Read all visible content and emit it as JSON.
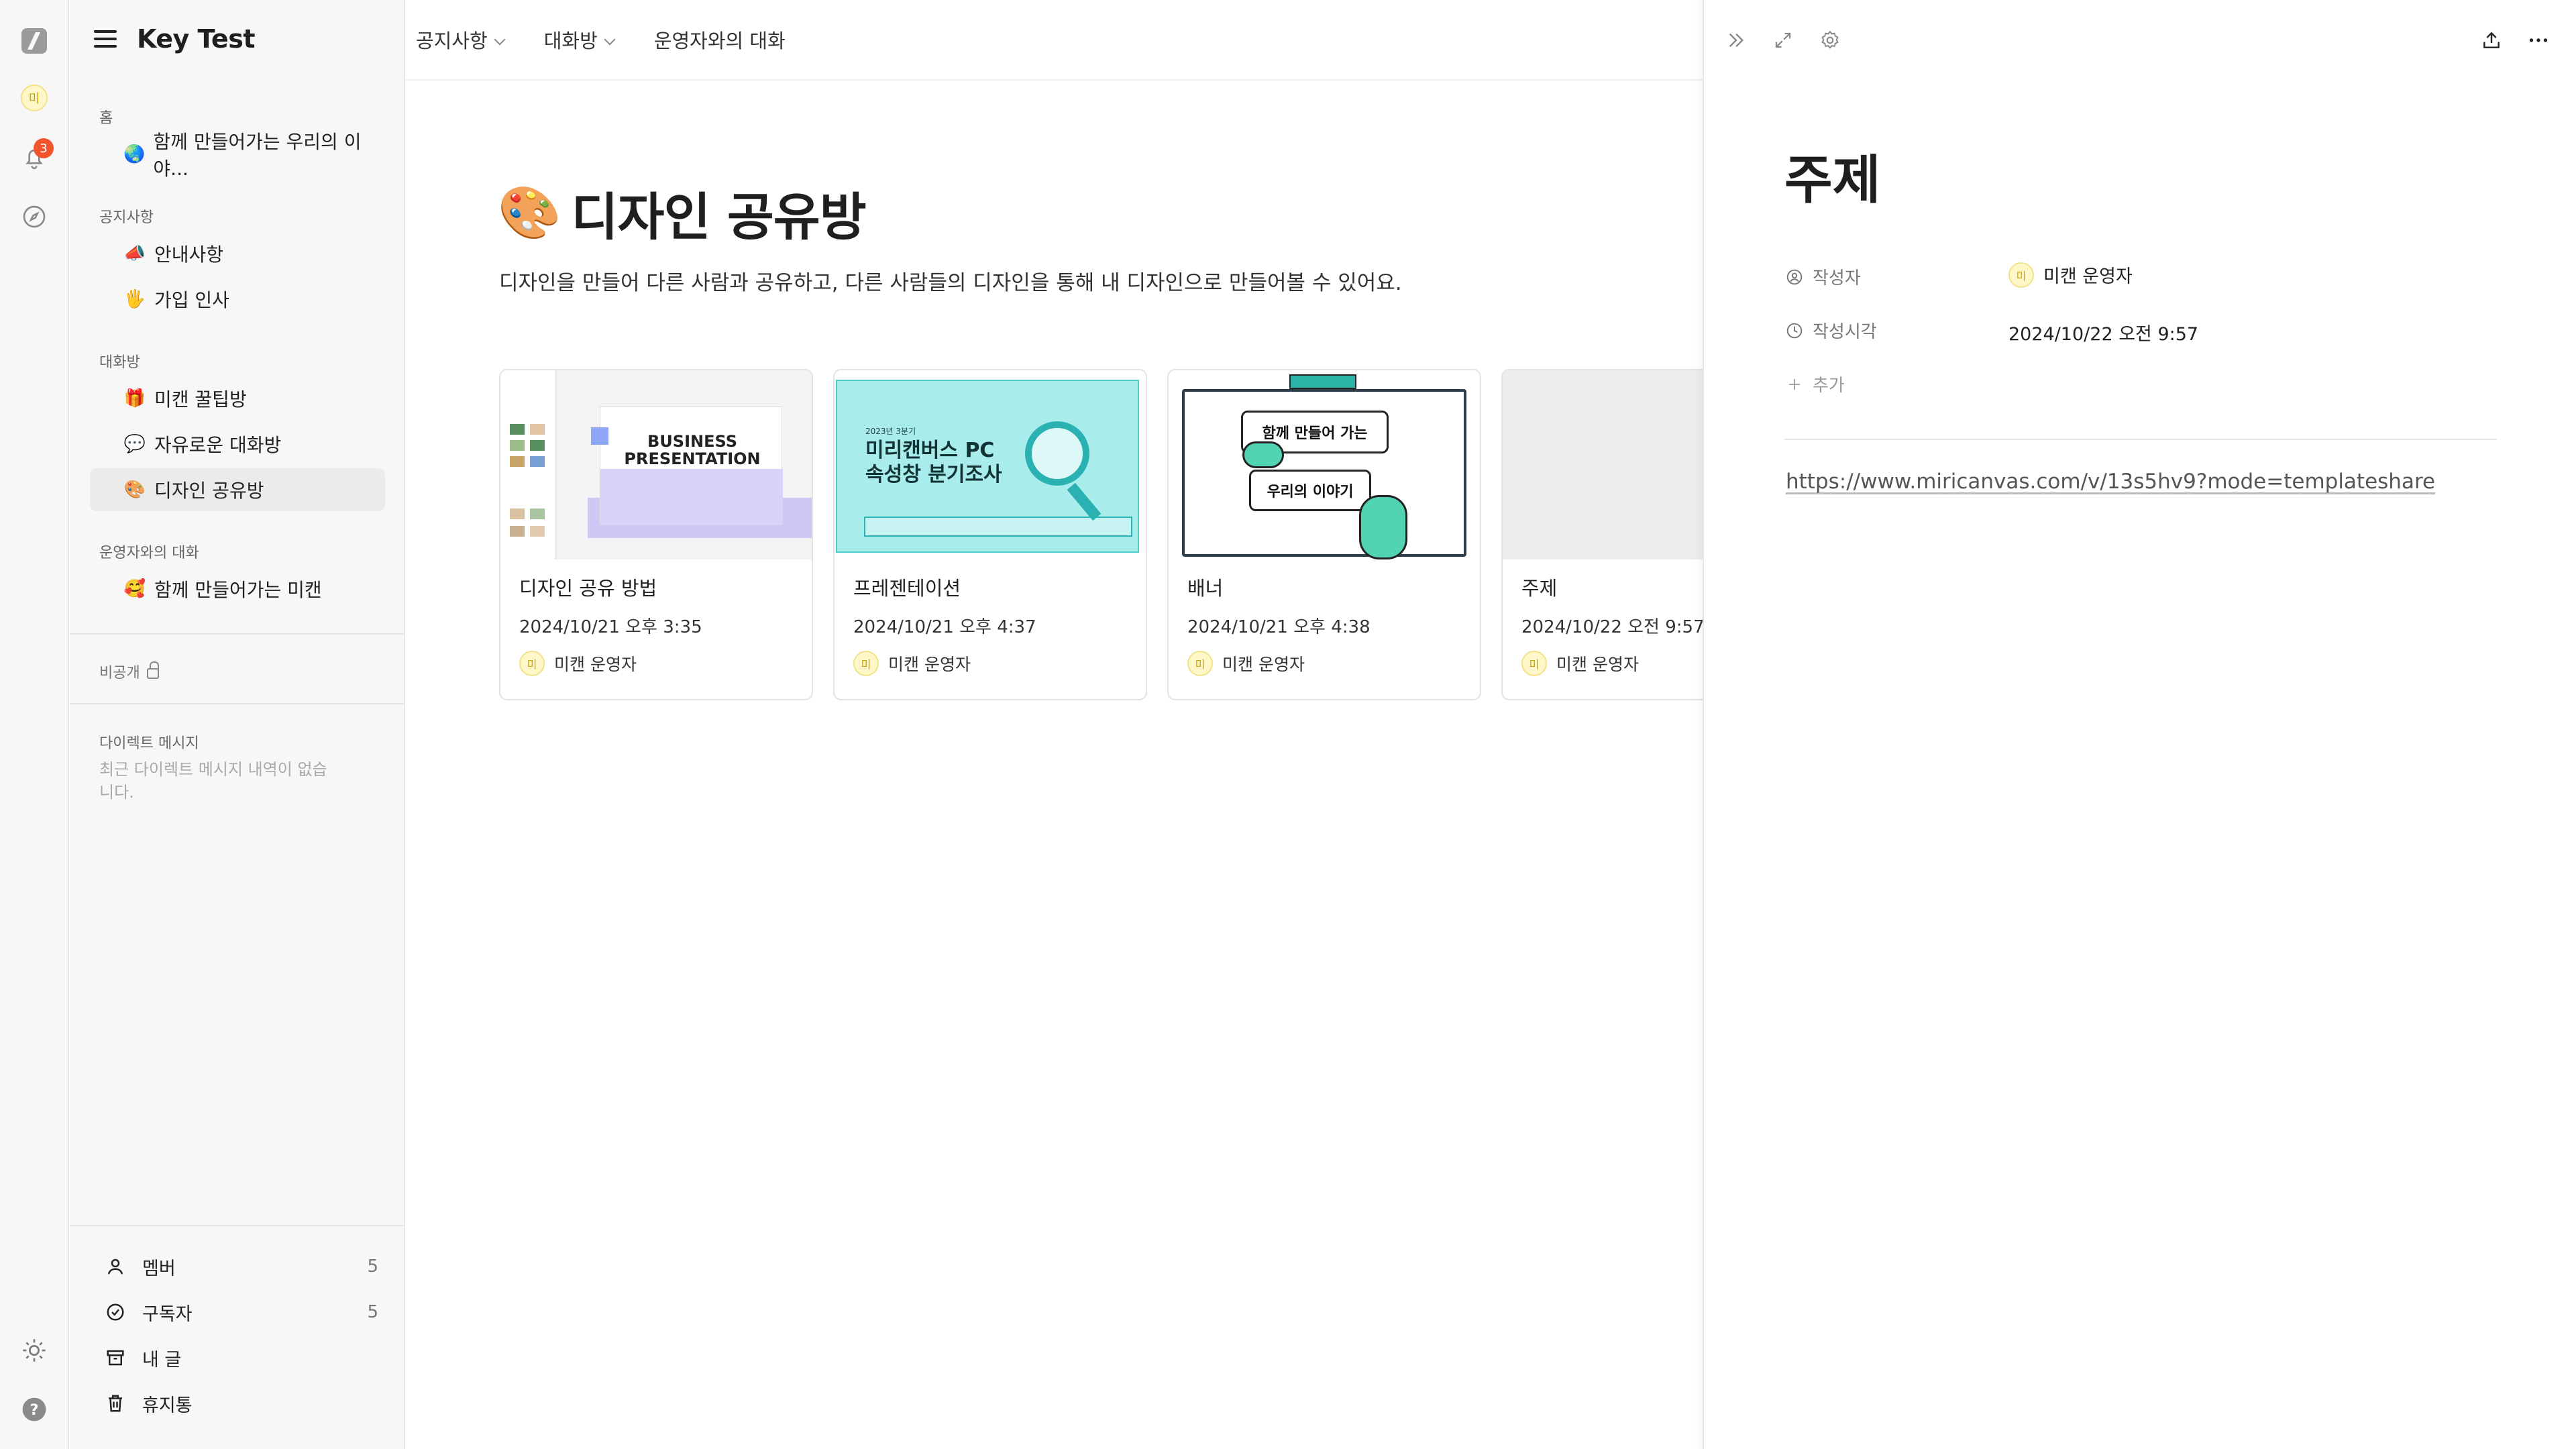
{
  "rail": {
    "user_initial": "미",
    "notification_count": "3"
  },
  "sidebar": {
    "workspace_name": "Key Test",
    "home_label": "홈",
    "home_items": [
      {
        "emoji": "🌏",
        "label": "함께 만들어가는 우리의 이야..."
      }
    ],
    "notice_label": "공지사항",
    "notice_items": [
      {
        "emoji": "📣",
        "label": "안내사항"
      },
      {
        "emoji": "🖐️",
        "label": "가입 인사"
      }
    ],
    "chat_label": "대화방",
    "chat_items": [
      {
        "emoji": "🎁",
        "label": "미캔 꿀팁방"
      },
      {
        "emoji": "💬",
        "label": "자유로운 대화방"
      },
      {
        "emoji": "🎨",
        "label": "디자인 공유방"
      }
    ],
    "operator_label": "운영자와의 대화",
    "operator_items": [
      {
        "emoji": "🥰",
        "label": "함께 만들어가는 미캔"
      }
    ],
    "private_label": "비공개",
    "dm_title": "다이렉트 메시지",
    "dm_empty": "최근 다이렉트 메시지 내역이 없습니다.",
    "bottom": [
      {
        "label": "멤버",
        "count": "5",
        "icon": "person-icon"
      },
      {
        "label": "구독자",
        "count": "5",
        "icon": "check-circle-icon"
      },
      {
        "label": "내 글",
        "count": "",
        "icon": "archive-icon"
      },
      {
        "label": "휴지통",
        "count": "",
        "icon": "trash-icon"
      }
    ]
  },
  "topnav": {
    "items": [
      "공지사항",
      "대화방",
      "운영자와의 대화"
    ]
  },
  "main": {
    "emoji": "🎨",
    "title": "디자인 공유방",
    "description": "디자인을 만들어 다른 사람과 공유하고, 다른 사람들의 디자인을 통해 내 디자인으로 만들어볼 수 있어요.",
    "cards": [
      {
        "title": "디자인 공유 방법",
        "date": "2024/10/21 오후 3:35",
        "author": "미캔 운영자",
        "author_initial": "미",
        "thumb_text": "BUSINESS PRESENTATION"
      },
      {
        "title": "프레젠테이션",
        "date": "2024/10/21 오후 4:37",
        "author": "미캔 운영자",
        "author_initial": "미",
        "thumb_text": "미리캔버스 PC 속성창 분기조사",
        "thumb_small": "2023년 3분기"
      },
      {
        "title": "배너",
        "date": "2024/10/21 오후 4:38",
        "author": "미캔 운영자",
        "author_initial": "미",
        "thumb_text_1": "함께 만들어 가는",
        "thumb_text_2": "우리의 이야기"
      },
      {
        "title": "주제",
        "date": "2024/10/22 오전 9:57",
        "author": "미캔 운영자",
        "author_initial": "미"
      }
    ]
  },
  "detail": {
    "title": "주제",
    "author_label": "작성자",
    "author_value": "미캔 운영자",
    "author_initial": "미",
    "time_label": "작성시각",
    "time_value": "2024/10/22 오전 9:57",
    "add_label": "추가",
    "link": "https://www.miricanvas.com/v/13s5hv9?mode=templateshare"
  },
  "colors": {
    "accent_badge": "#f2542d",
    "avatar_bg": "#fff7c8",
    "sidebar_bg": "#f7f7f7"
  }
}
